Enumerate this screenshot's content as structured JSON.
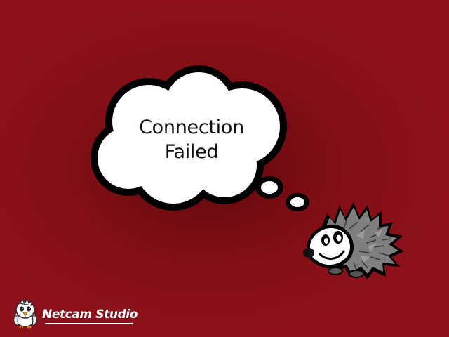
{
  "message": {
    "line1": "Connection",
    "line2": "Failed"
  },
  "brand": {
    "name": "Netcam Studio",
    "logo_icon": "eagle-mascot-icon"
  },
  "mascot_icon": "hedgehog-icon",
  "colors": {
    "background": "#8d111a",
    "bubble_fill": "#ffffff",
    "bubble_outline": "#000000",
    "hedgehog_spines": "#7a7a7a"
  }
}
